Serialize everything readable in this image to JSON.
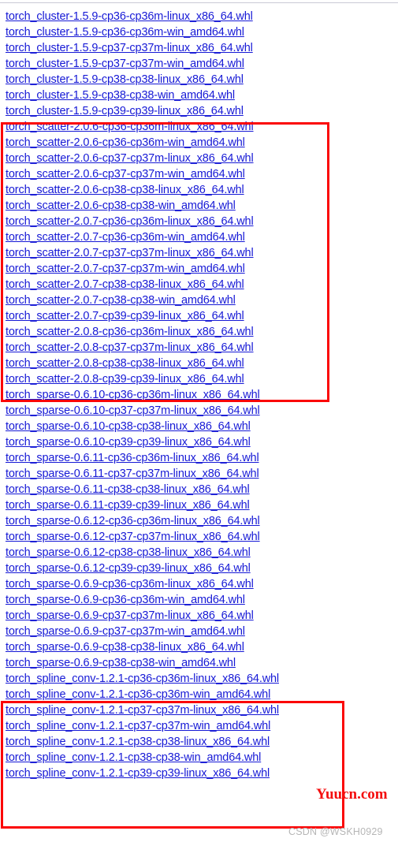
{
  "page": {
    "background_color": "#ffffff",
    "link_color": "#1619d6",
    "annotation_color": "#fb0707"
  },
  "file_list": {
    "items": [
      {
        "name": "torch_cluster-1.5.9-cp36-cp36m-linux_x86_64.whl"
      },
      {
        "name": "torch_cluster-1.5.9-cp36-cp36m-win_amd64.whl"
      },
      {
        "name": "torch_cluster-1.5.9-cp37-cp37m-linux_x86_64.whl"
      },
      {
        "name": "torch_cluster-1.5.9-cp37-cp37m-win_amd64.whl"
      },
      {
        "name": "torch_cluster-1.5.9-cp38-cp38-linux_x86_64.whl"
      },
      {
        "name": "torch_cluster-1.5.9-cp38-cp38-win_amd64.whl"
      },
      {
        "name": "torch_cluster-1.5.9-cp39-cp39-linux_x86_64.whl"
      },
      {
        "name": "torch_scatter-2.0.6-cp36-cp36m-linux_x86_64.whl"
      },
      {
        "name": "torch_scatter-2.0.6-cp36-cp36m-win_amd64.whl"
      },
      {
        "name": "torch_scatter-2.0.6-cp37-cp37m-linux_x86_64.whl"
      },
      {
        "name": "torch_scatter-2.0.6-cp37-cp37m-win_amd64.whl"
      },
      {
        "name": "torch_scatter-2.0.6-cp38-cp38-linux_x86_64.whl"
      },
      {
        "name": "torch_scatter-2.0.6-cp38-cp38-win_amd64.whl"
      },
      {
        "name": "torch_scatter-2.0.7-cp36-cp36m-linux_x86_64.whl"
      },
      {
        "name": "torch_scatter-2.0.7-cp36-cp36m-win_amd64.whl"
      },
      {
        "name": "torch_scatter-2.0.7-cp37-cp37m-linux_x86_64.whl"
      },
      {
        "name": "torch_scatter-2.0.7-cp37-cp37m-win_amd64.whl"
      },
      {
        "name": "torch_scatter-2.0.7-cp38-cp38-linux_x86_64.whl"
      },
      {
        "name": "torch_scatter-2.0.7-cp38-cp38-win_amd64.whl"
      },
      {
        "name": "torch_scatter-2.0.7-cp39-cp39-linux_x86_64.whl"
      },
      {
        "name": "torch_scatter-2.0.8-cp36-cp36m-linux_x86_64.whl"
      },
      {
        "name": "torch_scatter-2.0.8-cp37-cp37m-linux_x86_64.whl"
      },
      {
        "name": "torch_scatter-2.0.8-cp38-cp38-linux_x86_64.whl"
      },
      {
        "name": "torch_scatter-2.0.8-cp39-cp39-linux_x86_64.whl"
      },
      {
        "name": "torch_sparse-0.6.10-cp36-cp36m-linux_x86_64.whl"
      },
      {
        "name": "torch_sparse-0.6.10-cp37-cp37m-linux_x86_64.whl"
      },
      {
        "name": "torch_sparse-0.6.10-cp38-cp38-linux_x86_64.whl"
      },
      {
        "name": "torch_sparse-0.6.10-cp39-cp39-linux_x86_64.whl"
      },
      {
        "name": "torch_sparse-0.6.11-cp36-cp36m-linux_x86_64.whl"
      },
      {
        "name": "torch_sparse-0.6.11-cp37-cp37m-linux_x86_64.whl"
      },
      {
        "name": "torch_sparse-0.6.11-cp38-cp38-linux_x86_64.whl"
      },
      {
        "name": "torch_sparse-0.6.11-cp39-cp39-linux_x86_64.whl"
      },
      {
        "name": "torch_sparse-0.6.12-cp36-cp36m-linux_x86_64.whl"
      },
      {
        "name": "torch_sparse-0.6.12-cp37-cp37m-linux_x86_64.whl"
      },
      {
        "name": "torch_sparse-0.6.12-cp38-cp38-linux_x86_64.whl"
      },
      {
        "name": "torch_sparse-0.6.12-cp39-cp39-linux_x86_64.whl"
      },
      {
        "name": "torch_sparse-0.6.9-cp36-cp36m-linux_x86_64.whl"
      },
      {
        "name": "torch_sparse-0.6.9-cp36-cp36m-win_amd64.whl"
      },
      {
        "name": "torch_sparse-0.6.9-cp37-cp37m-linux_x86_64.whl"
      },
      {
        "name": "torch_sparse-0.6.9-cp37-cp37m-win_amd64.whl"
      },
      {
        "name": "torch_sparse-0.6.9-cp38-cp38-linux_x86_64.whl"
      },
      {
        "name": "torch_sparse-0.6.9-cp38-cp38-win_amd64.whl"
      },
      {
        "name": "torch_spline_conv-1.2.1-cp36-cp36m-linux_x86_64.whl"
      },
      {
        "name": "torch_spline_conv-1.2.1-cp36-cp36m-win_amd64.whl"
      },
      {
        "name": "torch_spline_conv-1.2.1-cp37-cp37m-linux_x86_64.whl"
      },
      {
        "name": "torch_spline_conv-1.2.1-cp37-cp37m-win_amd64.whl"
      },
      {
        "name": "torch_spline_conv-1.2.1-cp38-cp38-linux_x86_64.whl"
      },
      {
        "name": "torch_spline_conv-1.2.1-cp38-cp38-win_amd64.whl"
      },
      {
        "name": "torch_spline_conv-1.2.1-cp39-cp39-linux_x86_64.whl"
      }
    ]
  },
  "annotations": [
    {
      "id": "scatter",
      "label": "torch_scatter highlight rectangle"
    },
    {
      "id": "spline",
      "label": "torch_spline_conv highlight rectangle"
    }
  ],
  "watermarks": {
    "site": "Yuucn.com",
    "author": "CSDN @WSKH0929"
  }
}
